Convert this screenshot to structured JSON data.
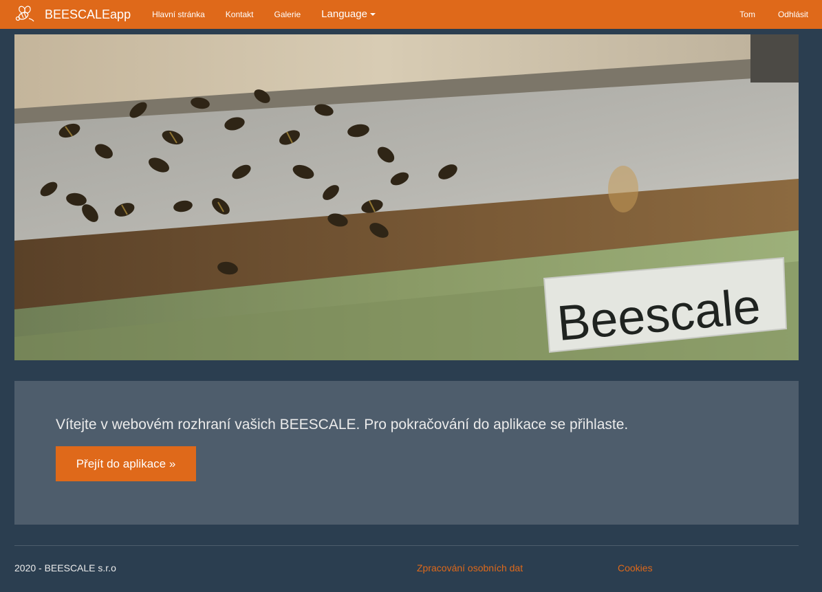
{
  "navbar": {
    "brand": "BEESCALEapp",
    "brand_logo_icon": "bee-icon",
    "links": [
      "Hlavní stránka",
      "Kontakt",
      "Galerie"
    ],
    "language_label": "Language",
    "user": "Tom",
    "logout": "Odhlásit"
  },
  "hero": {
    "sign_text": "Beescale"
  },
  "jumbotron": {
    "message": "Vítejte v webovém rozhraní vašich BEESCALE. Pro pokračování do aplikace se přihlaste.",
    "button_label": "Přejít do aplikace »"
  },
  "footer": {
    "copyright": "2020 - BEESCALE s.r.o",
    "privacy_link": "Zpracování osobních dat",
    "cookies_link": "Cookies"
  },
  "colors": {
    "accent": "#df691a",
    "background": "#2b3e50",
    "panel": "#4e5d6c"
  }
}
